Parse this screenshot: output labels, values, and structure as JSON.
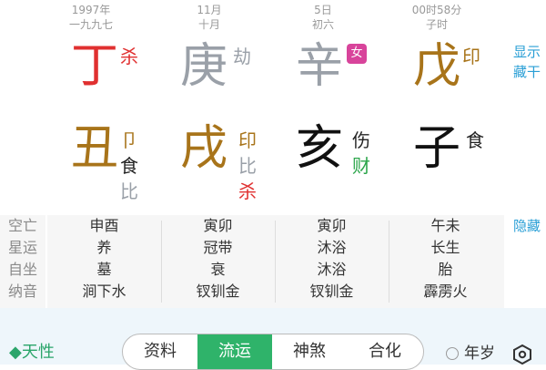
{
  "columns": [
    {
      "date_top": "1997年",
      "date_sub": "一九九七",
      "stem": {
        "char": "丁",
        "color": "#e03030",
        "god": "杀",
        "god_color": "#e03030"
      },
      "branch": {
        "char": "丑",
        "color": "#a8741a"
      },
      "hidden": [
        {
          "text": "卩",
          "color": "#a8741a"
        },
        {
          "text": "食",
          "color": "#222222"
        },
        {
          "text": "比",
          "color": "#9aa0a8"
        }
      ],
      "info": [
        "申酉",
        "养",
        "墓",
        "涧下水"
      ]
    },
    {
      "date_top": "11月",
      "date_sub": "十月",
      "stem": {
        "char": "庚",
        "color": "#9aa0a8",
        "god": "劫",
        "god_color": "#9aa0a8"
      },
      "branch": {
        "char": "戌",
        "color": "#a8741a"
      },
      "hidden": [
        {
          "text": "印",
          "color": "#a8741a"
        },
        {
          "text": "比",
          "color": "#9aa0a8"
        },
        {
          "text": "杀",
          "color": "#e03030"
        }
      ],
      "info": [
        "寅卯",
        "冠带",
        "衰",
        "钗钏金"
      ]
    },
    {
      "date_top": "5日",
      "date_sub": "初六",
      "stem": {
        "char": "辛",
        "color": "#9aa0a8",
        "badge": "女"
      },
      "branch": {
        "char": "亥",
        "color": "#111111"
      },
      "hidden": [
        {
          "text": "伤",
          "color": "#222222"
        },
        {
          "text": "财",
          "color": "#2ba54a"
        }
      ],
      "info": [
        "寅卯",
        "沐浴",
        "沐浴",
        "钗钏金"
      ]
    },
    {
      "date_top": "00时58分",
      "date_sub": "子时",
      "stem": {
        "char": "戊",
        "color": "#a8741a",
        "god": "印",
        "god_color": "#a8741a"
      },
      "branch": {
        "char": "子",
        "color": "#111111"
      },
      "hidden": [
        {
          "text": "食",
          "color": "#222222"
        }
      ],
      "info": [
        "午未",
        "长生",
        "胎",
        "霹雳火"
      ]
    }
  ],
  "side": {
    "show_line1": "显示",
    "show_line2": "藏干",
    "hide": "隐藏"
  },
  "info_labels": [
    "空亡",
    "星运",
    "自坐",
    "纳音"
  ],
  "bottom": {
    "tianxing": "◆天性",
    "tabs": [
      "资料",
      "流运",
      "神煞",
      "合化"
    ],
    "active_tab": 1,
    "nianyun": "年岁"
  },
  "colors": {
    "accent_green": "#2fb36a",
    "link_blue": "#2a9fd6",
    "badge_pink": "#d8449b"
  }
}
